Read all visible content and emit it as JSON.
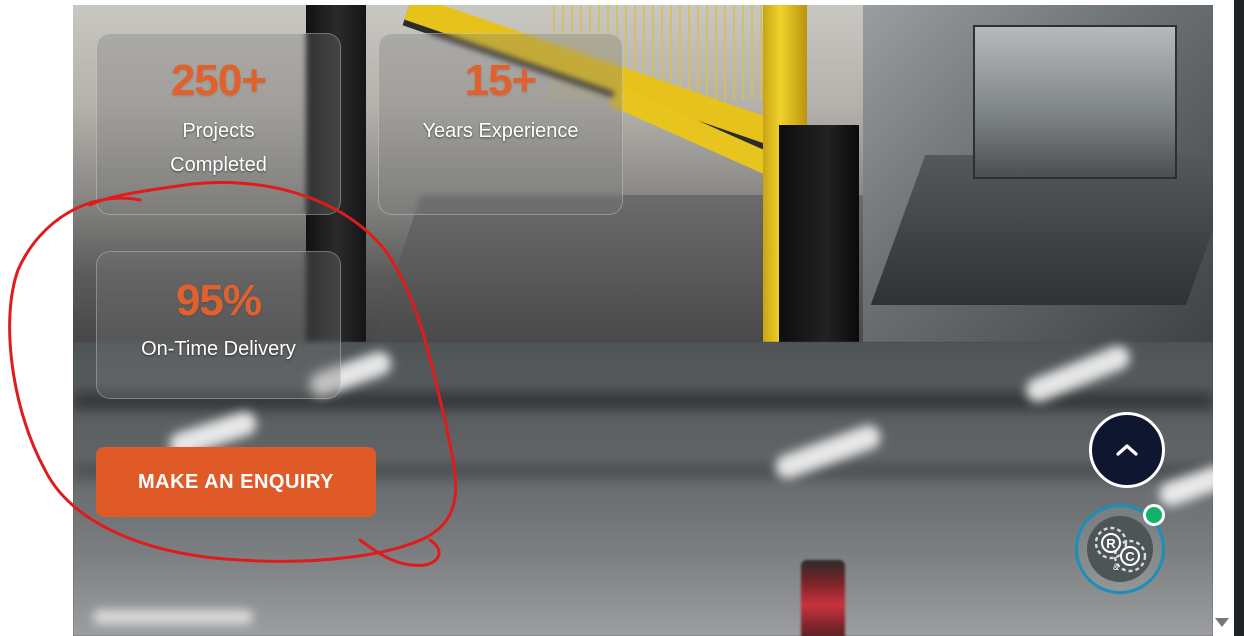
{
  "stats": [
    {
      "value": "250+",
      "label": "Projects Completed"
    },
    {
      "value": "15+",
      "label": "Years Experience"
    },
    {
      "value": "95%",
      "label": "On-Time Delivery"
    }
  ],
  "cta": {
    "label": "MAKE AN ENQUIRY"
  },
  "logo": {
    "letters": "R&C"
  },
  "colors": {
    "accent": "#e05a28",
    "stat_value": "#e0612d",
    "scroll_button_bg": "#0f1730",
    "logo_ring": "#1a8fb8",
    "status_online": "#13b26b",
    "annotation": "#e01b1b"
  },
  "icons": {
    "scroll_top": "chevron-up-icon",
    "scrollbar_arrow": "triangle-down-icon"
  }
}
